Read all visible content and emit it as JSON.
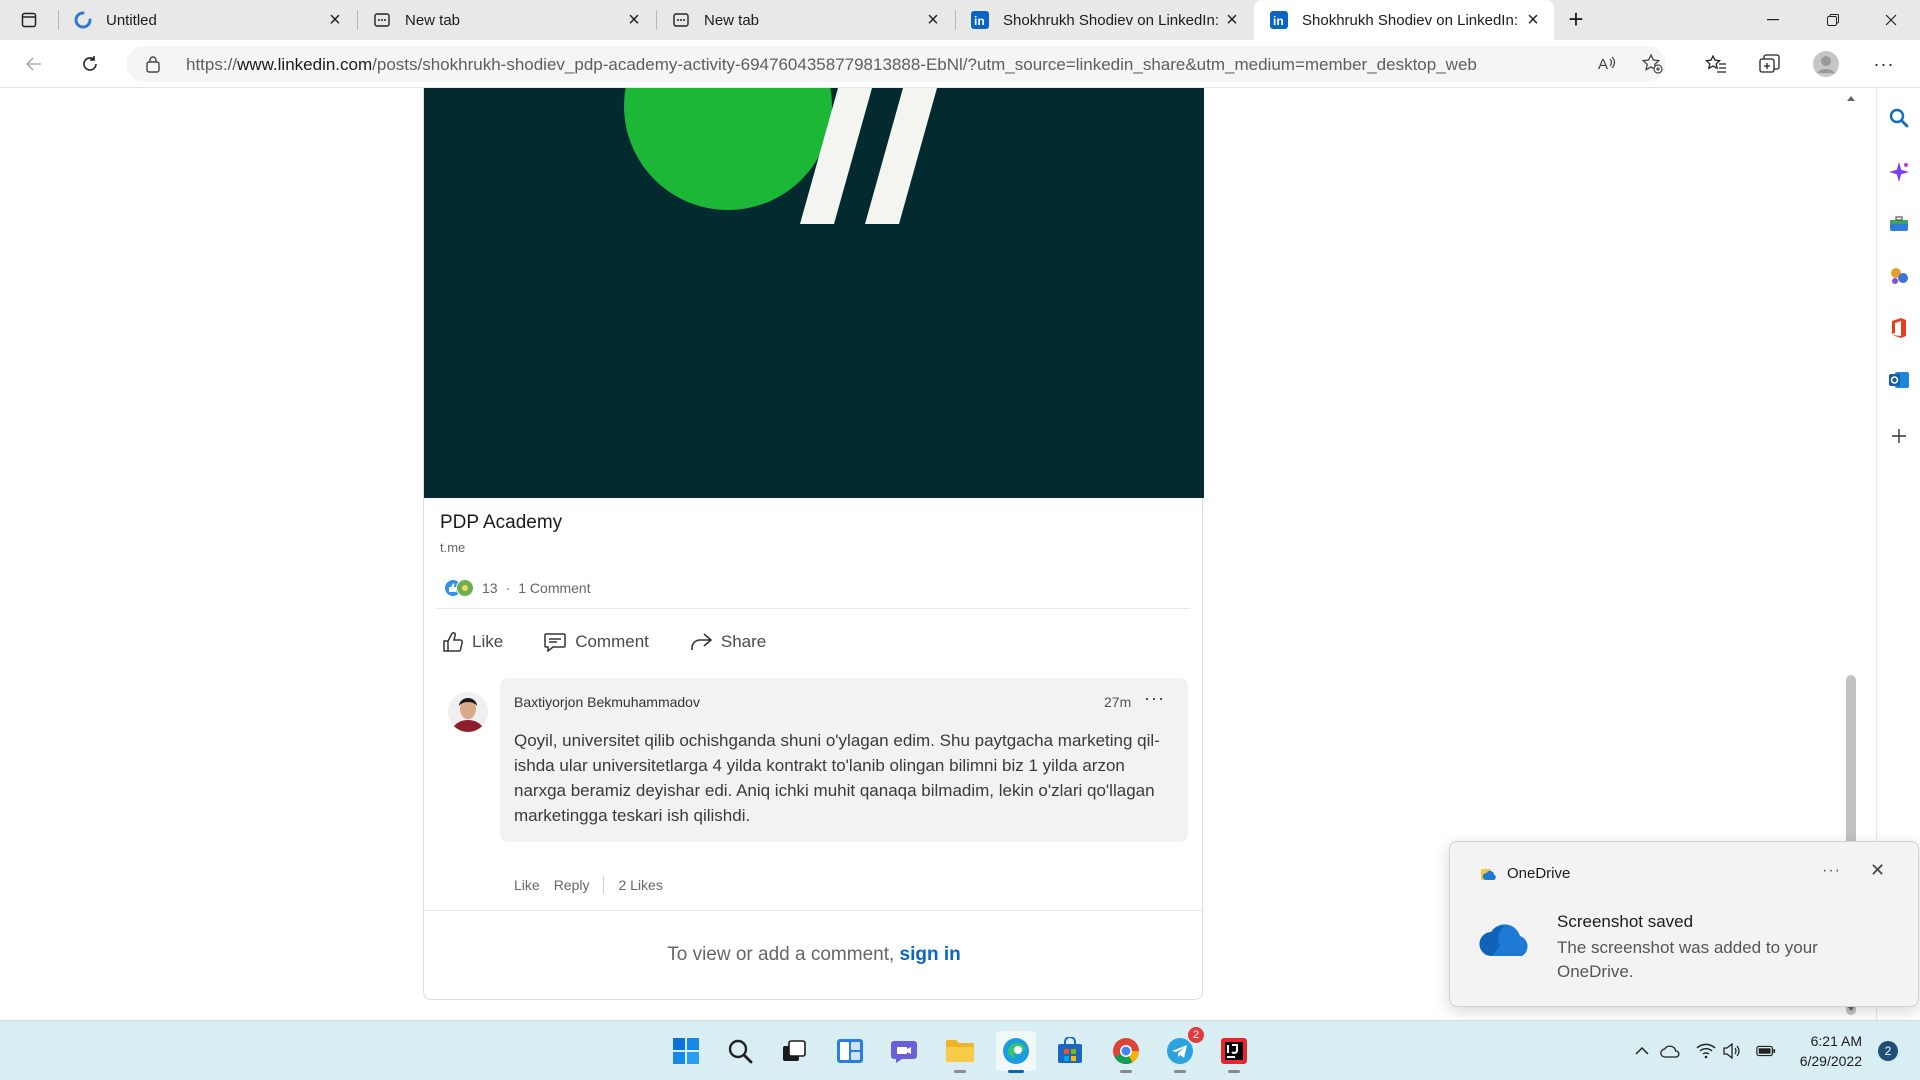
{
  "browser": {
    "tabs": [
      {
        "label": "Untitled",
        "icon": "edge-loading-icon",
        "active": false
      },
      {
        "label": "New tab",
        "icon": "new-tab-icon",
        "active": false
      },
      {
        "label": "New tab",
        "icon": "new-tab-icon",
        "active": false
      },
      {
        "label": "Shokhrukh Shodiev on LinkedIn:",
        "icon": "linkedin-icon",
        "active": false
      },
      {
        "label": "Shokhrukh Shodiev on LinkedIn:",
        "icon": "linkedin-icon",
        "active": true
      }
    ],
    "address": {
      "prefix": "https://",
      "host": "www.linkedin.com",
      "path": "/posts/shokhrukh-shodiev_pdp-academy-activity-6947604358779813888-EbNl/?utm_source=linkedin_share&utm_medium=member_desktop_web"
    }
  },
  "post": {
    "link_title": "PDP Academy",
    "link_domain": "t.me",
    "reaction_count": "13",
    "comments_link": "1 Comment",
    "actions": {
      "like": "Like",
      "comment": "Comment",
      "share": "Share"
    },
    "hero_colors": {
      "background": "#032a2f",
      "circle": "#1db737",
      "slashes": "#f4f4f0"
    }
  },
  "comment": {
    "author": "Baxtiyorjon Bekmuhammadov",
    "time": "27m",
    "more": "···",
    "text": "Qoyil, universitet qilib ochishganda shuni o'ylagan edim. Shu paytgacha marketing qil-ishda ular universitetlarga 4 yilda kontrakt to'lanib olingan bilimni biz 1 yilda arzon narxga beramiz deyishar edi. Aniq ichki muhit qanaqa bilmadim, lekin o'zlari qo'llagan marketingga teskari ish qilishdi.",
    "like": "Like",
    "reply": "Reply",
    "likes": "2 Likes"
  },
  "signin": {
    "prefix": "To view or add a comment,",
    "link": "sign in"
  },
  "toast": {
    "app": "OneDrive",
    "more": "···",
    "close": "✕",
    "title": "Screenshot saved",
    "body": "The screenshot was added to your OneDrive."
  },
  "taskbar": {
    "time": "6:21 AM",
    "date": "6/29/2022",
    "notifications": "2",
    "telegram_badge": "2"
  },
  "colors": {
    "linkedin_blue": "#0a66c2",
    "taskbar": "#d9eef3",
    "edge_accent": "#0067c0"
  }
}
